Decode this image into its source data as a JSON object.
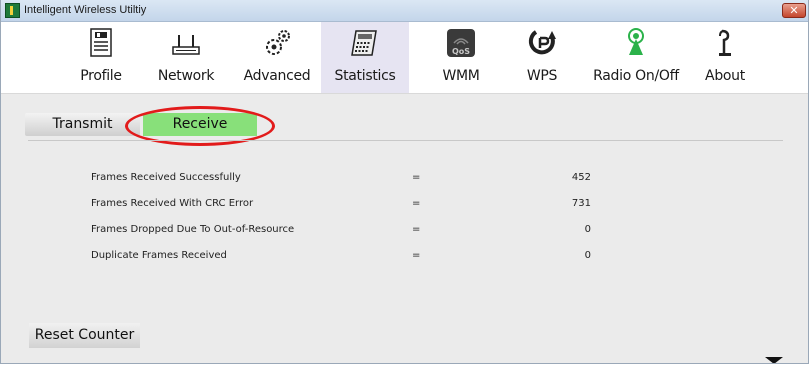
{
  "window": {
    "title": "Intelligent Wireless Utiltiy",
    "close_label": "✕"
  },
  "toolbar": {
    "items": [
      {
        "label": "Profile",
        "icon": "profile-icon"
      },
      {
        "label": "Network",
        "icon": "network-icon"
      },
      {
        "label": "Advanced",
        "icon": "gears-icon"
      },
      {
        "label": "Statistics",
        "icon": "statistics-icon",
        "active": true
      },
      {
        "label": "WMM",
        "icon": "qos-icon"
      },
      {
        "label": "WPS",
        "icon": "wps-icon"
      },
      {
        "label": "Radio On/Off",
        "icon": "radio-icon"
      },
      {
        "label": "About",
        "icon": "about-icon"
      }
    ],
    "qos_badge": "QoS"
  },
  "tabs": {
    "transmit": "Transmit",
    "receive": "Receive",
    "active": "receive"
  },
  "stats": [
    {
      "label": "Frames Received Successfully",
      "eq": "=",
      "value": "452"
    },
    {
      "label": "Frames Received With CRC Error",
      "eq": "=",
      "value": "731"
    },
    {
      "label": "Frames Dropped Due To Out-of-Resource",
      "eq": "=",
      "value": "0"
    },
    {
      "label": "Duplicate Frames Received",
      "eq": "=",
      "value": "0"
    }
  ],
  "reset_button": "Reset Counter",
  "colors": {
    "active_tab": "#88e07a",
    "highlight": "#e21b1b",
    "active_toolbar": "#e6e4f2"
  }
}
